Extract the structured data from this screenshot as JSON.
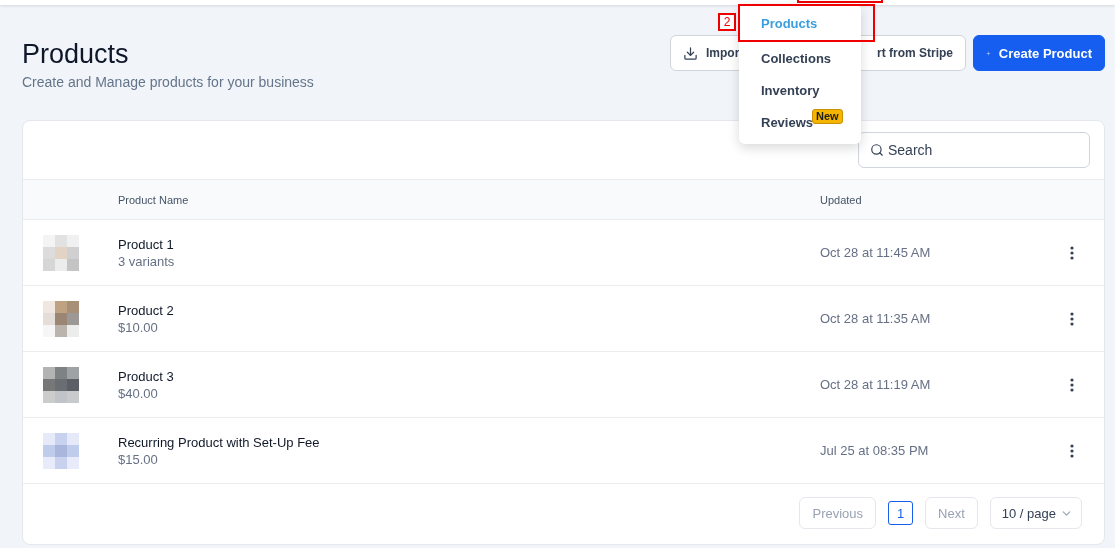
{
  "page": {
    "title": "Products",
    "subtitle": "Create and Manage products for your business"
  },
  "actions": [
    {
      "kind": "import",
      "label": "Impor"
    },
    {
      "kind": "stripe",
      "label": "rt from Stripe"
    },
    {
      "kind": "create",
      "label": "Create Product"
    }
  ],
  "menu": {
    "items": [
      {
        "label": "Products",
        "selected": true
      },
      {
        "label": "Collections",
        "selected": false
      },
      {
        "label": "Inventory",
        "selected": false
      },
      {
        "label": "Reviews",
        "selected": false,
        "badge": "New"
      }
    ]
  },
  "annotation": {
    "label": "2"
  },
  "search": {
    "placeholder": "Search"
  },
  "table": {
    "columns": [
      "Product Name",
      "Updated"
    ],
    "rows": [
      {
        "name": "Product 1",
        "detail": "3 variants",
        "updated": "Oct 28 at 11:45 AM"
      },
      {
        "name": "Product 2",
        "detail": "$10.00",
        "updated": "Oct 28 at 11:35 AM"
      },
      {
        "name": "Product 3",
        "detail": "$40.00",
        "updated": "Oct 28 at 11:19 AM"
      },
      {
        "name": "Recurring Product with Set-Up Fee",
        "detail": "$15.00",
        "updated": "Jul 25 at 08:35 PM"
      }
    ]
  },
  "pagination": {
    "previous": "Previous",
    "page": "1",
    "next": "Next",
    "size": "10 / page"
  }
}
